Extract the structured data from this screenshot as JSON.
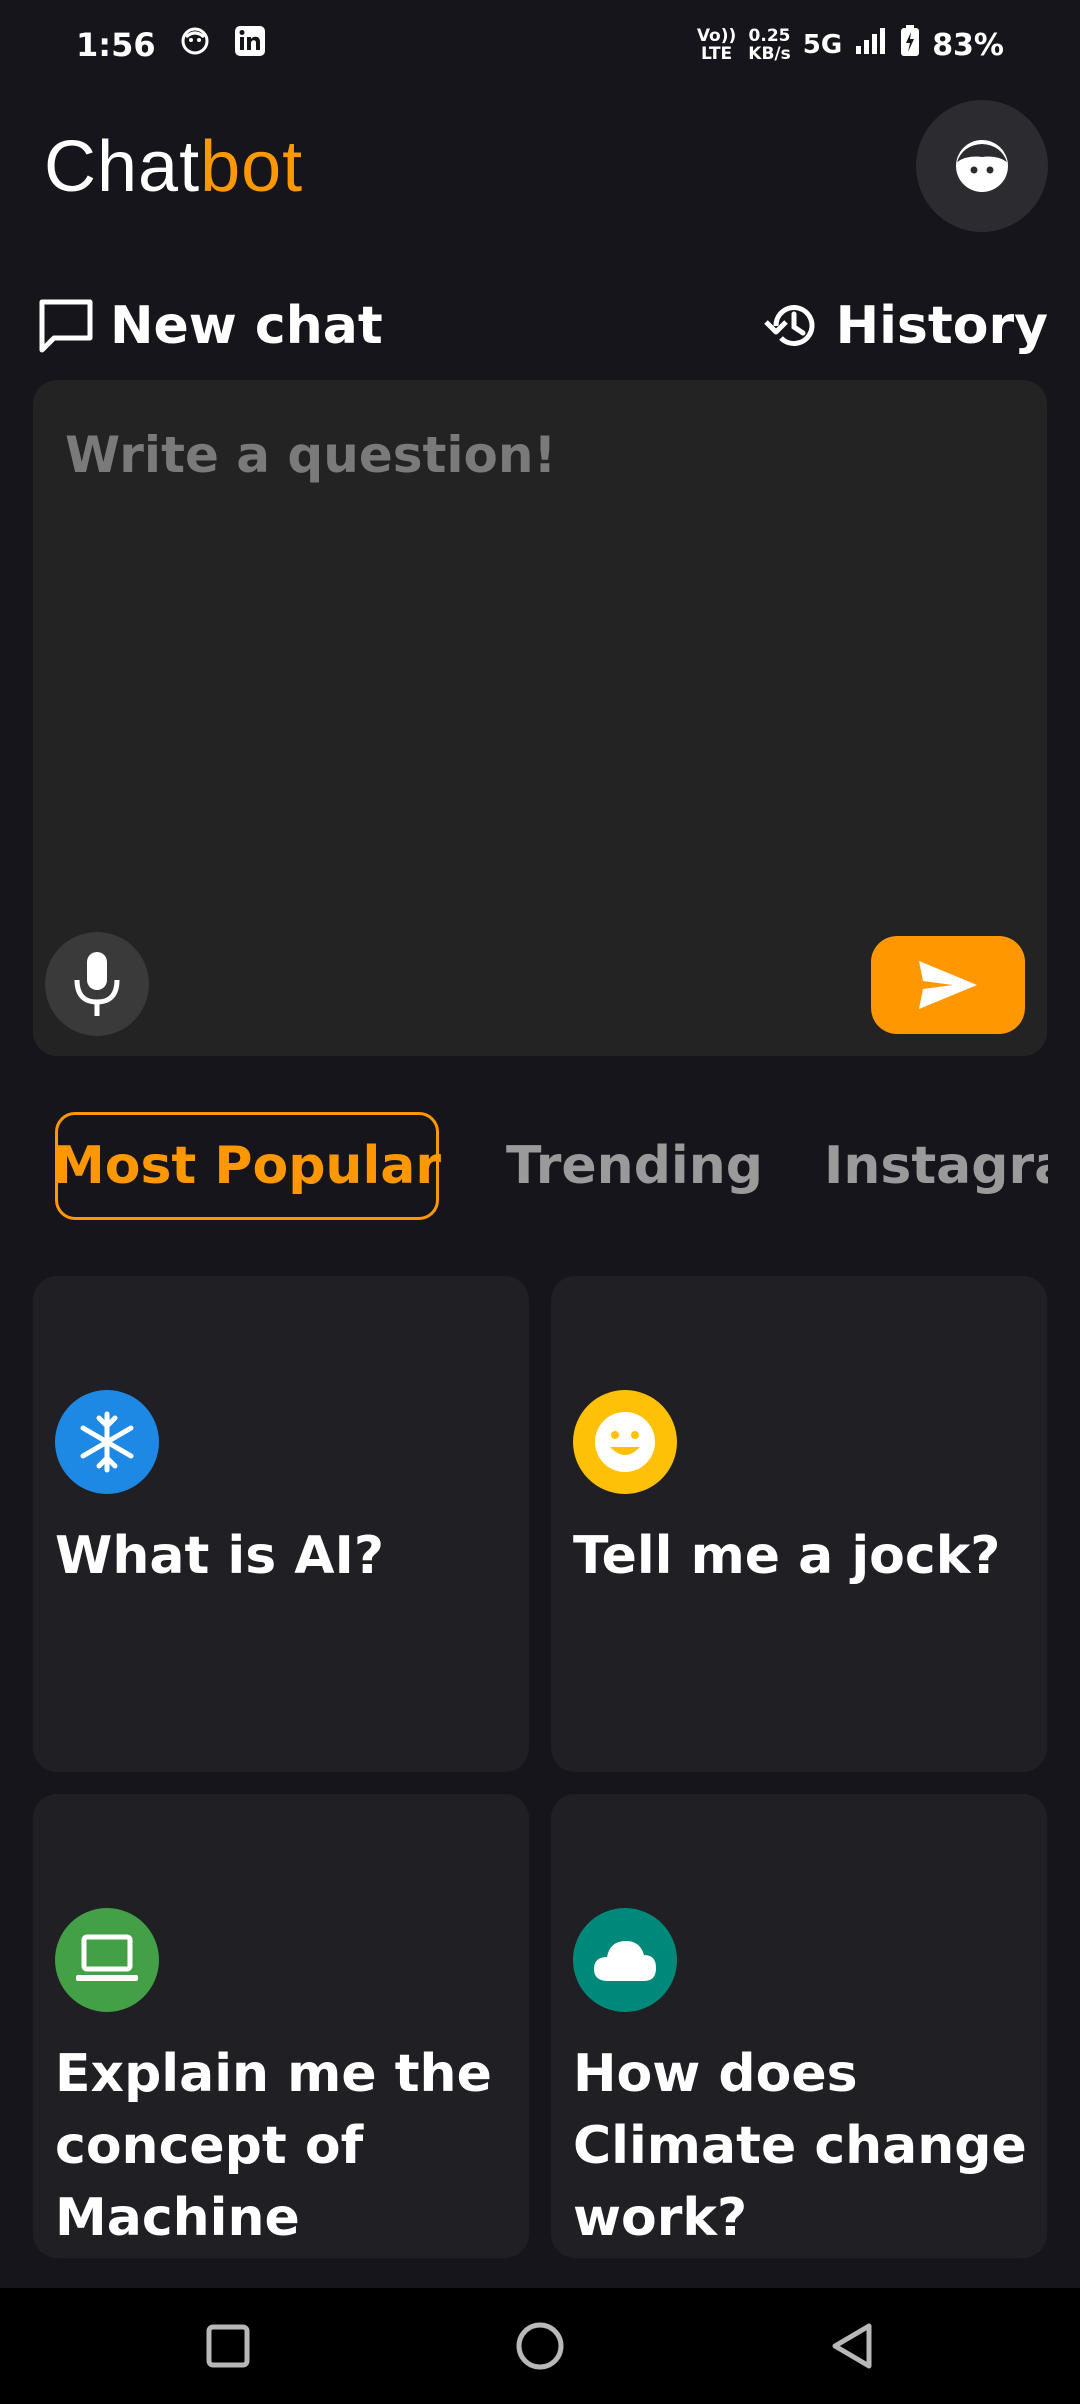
{
  "status_bar": {
    "time": "1:56",
    "network_speed_value": "0.25",
    "network_speed_unit": "KB/s",
    "volte_top": "Vo))",
    "volte_bottom": "LTE",
    "network_type": "5G",
    "battery": "83%"
  },
  "header": {
    "title_part1": "Chat",
    "title_part2": "bot",
    "accent_color": "#ff9800"
  },
  "actions": {
    "new_chat_label": "New chat",
    "history_label": "History"
  },
  "question": {
    "placeholder": "Write a question!",
    "value": ""
  },
  "tabs": [
    {
      "label": "Most Popular",
      "active": true
    },
    {
      "label": "Trending",
      "active": false
    },
    {
      "label": "Instagram",
      "active": false
    }
  ],
  "cards": [
    {
      "icon": "snowflake-icon",
      "color": "#1e88e5",
      "text": "What is AI?"
    },
    {
      "icon": "smiley-icon",
      "color": "#ffc107",
      "text": "Tell me a jock?"
    },
    {
      "icon": "laptop-icon",
      "color": "#43a047",
      "text": "Explain me the concept of Machine"
    },
    {
      "icon": "cloud-icon",
      "color": "#00897b",
      "text": "How does Climate change work?"
    }
  ],
  "nav_bar": {
    "icons": [
      "square-icon",
      "circle-icon",
      "triangle-back-icon"
    ]
  }
}
